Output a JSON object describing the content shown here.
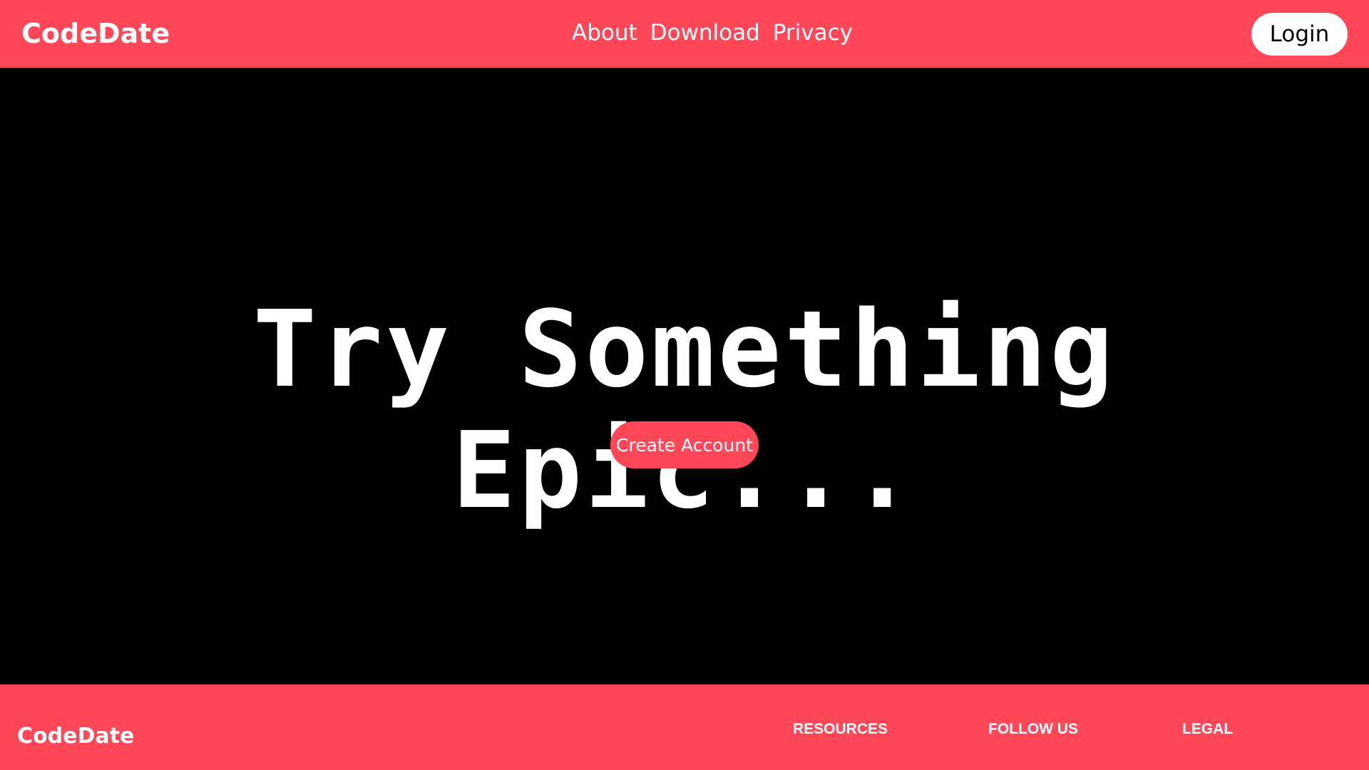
{
  "header": {
    "brand": "CodeDate",
    "nav": [
      "About",
      "Download",
      "Privacy"
    ],
    "login_label": "Login"
  },
  "hero": {
    "title": "Try Something Epic...",
    "cta_label": "Create Account"
  },
  "footer": {
    "brand": "CodeDate",
    "columns": [
      "RESOURCES",
      "FOLLOW US",
      "LEGAL"
    ]
  },
  "colors": {
    "accent": "#ff4757",
    "background": "#000000",
    "text": "#ffffff"
  }
}
